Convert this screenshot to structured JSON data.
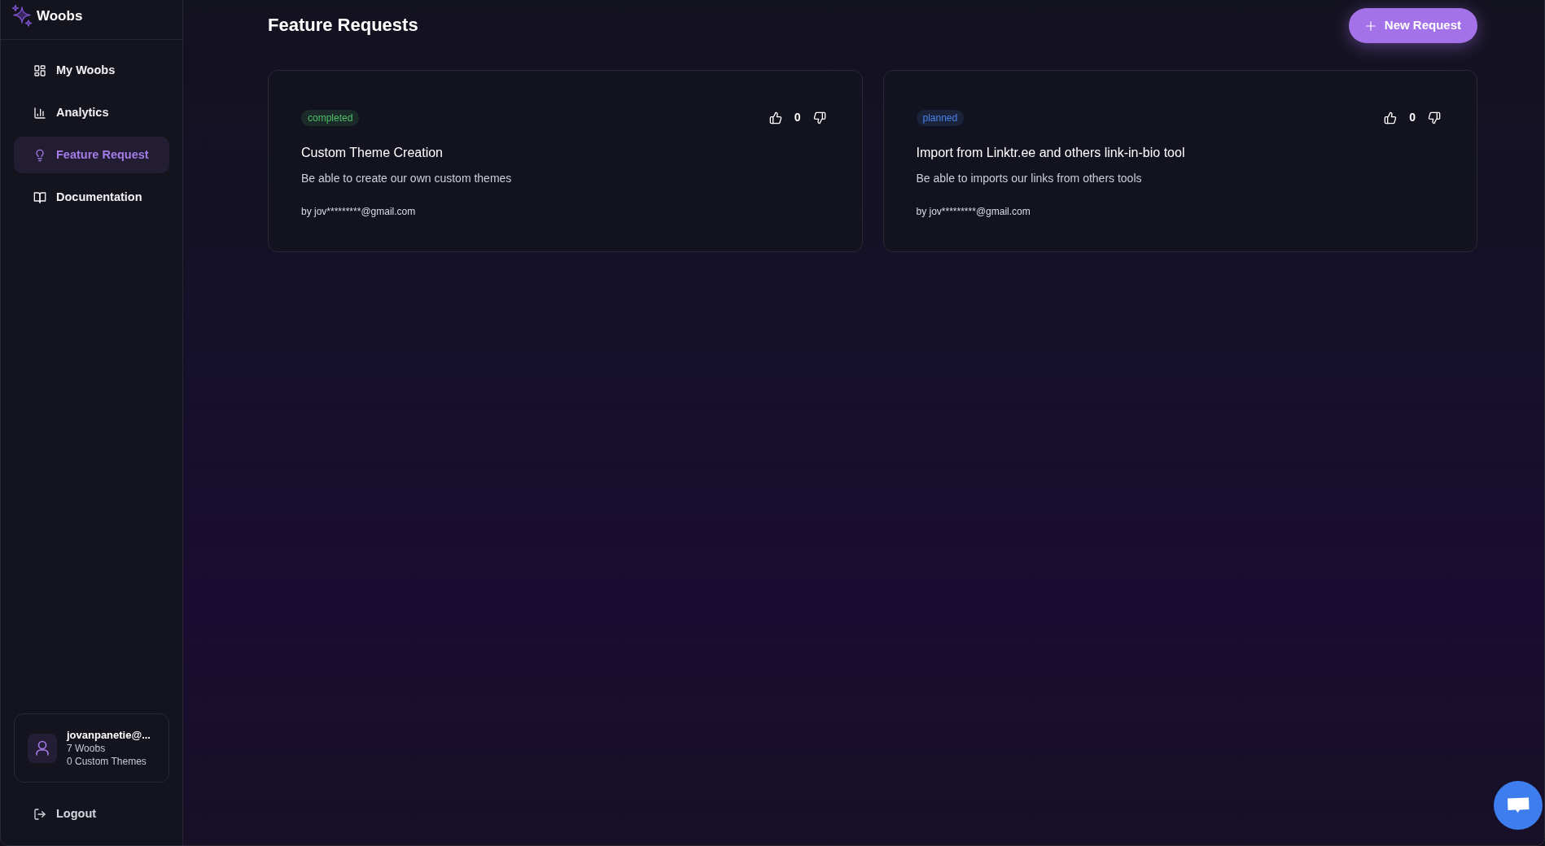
{
  "brand": {
    "name": "Woobs"
  },
  "sidebar": {
    "items": [
      {
        "label": "My Woobs",
        "selected": false
      },
      {
        "label": "Analytics",
        "selected": false
      },
      {
        "label": "Feature Request",
        "selected": true
      },
      {
        "label": "Documentation",
        "selected": false
      }
    ],
    "account": {
      "email": "jovanpanetie@...",
      "woobs": "7 Woobs",
      "themes": "0 Custom Themes"
    },
    "logout": "Logout"
  },
  "header": {
    "title": "Feature Requests",
    "new_button": "New Request"
  },
  "requests": [
    {
      "status": "completed",
      "color": "#4fbf67",
      "votes": "0",
      "title": "Custom Theme Creation",
      "description": "Be able to create our own custom themes",
      "author": "by jov*********@gmail.com"
    },
    {
      "status": "planned",
      "color": "#4a82ea",
      "votes": "0",
      "title": "Import from Linktr.ee and others link-in-bio tool",
      "description": "Be able to imports our links from others tools",
      "author": "by jov*********@gmail.com"
    }
  ]
}
